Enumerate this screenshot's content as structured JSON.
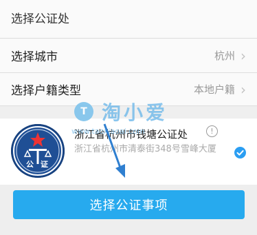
{
  "section": {
    "title": "选择公证处"
  },
  "city_row": {
    "label": "选择城市",
    "value": "杭州"
  },
  "hukou_row": {
    "label": "选择户籍类型",
    "value": "本地户籍"
  },
  "office": {
    "name": "浙江省杭州市钱塘公证处",
    "address": "浙江省杭州市清泰街348号雪峰大厦",
    "emblem_text": "公证"
  },
  "watermark": {
    "badge": "T",
    "text": "淘小爱",
    "url": "www.taoxiaoai.com"
  },
  "button": {
    "label": "选择公证事项"
  },
  "icons": {
    "chevron": "chevron-right-icon",
    "info": "info-icon",
    "check": "check-circle-icon"
  },
  "colors": {
    "accent": "#27aaee",
    "emblem": "#1f4f95",
    "check": "#2b9ef2"
  }
}
